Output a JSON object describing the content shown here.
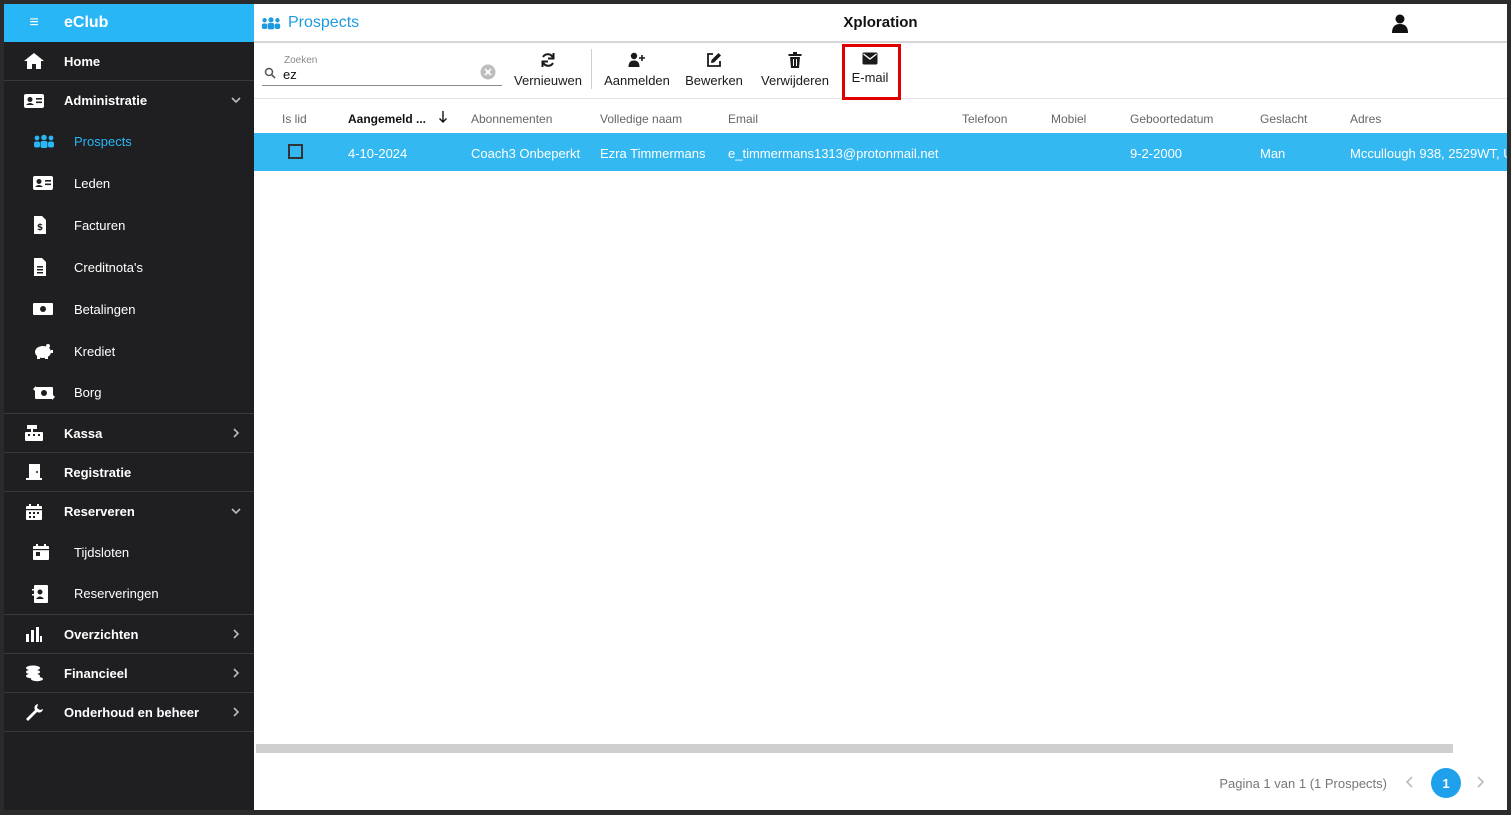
{
  "app": {
    "brand": "eClub",
    "org_title": "Xploration",
    "page_title": "Prospects"
  },
  "sidebar": {
    "home": "Home",
    "administratie": "Administratie",
    "admin_items": [
      "Prospects",
      "Leden",
      "Facturen",
      "Creditnota's",
      "Betalingen",
      "Krediet",
      "Borg"
    ],
    "kassa": "Kassa",
    "registratie": "Registratie",
    "reserveren": "Reserveren",
    "res_items": [
      "Tijdsloten",
      "Reserveringen"
    ],
    "overzichten": "Overzichten",
    "financieel": "Financieel",
    "onderhoud": "Onderhoud en beheer"
  },
  "search": {
    "placeholder": "Zoeken",
    "value": "ez"
  },
  "toolbar": {
    "refresh": "Vernieuwen",
    "register": "Aanmelden",
    "edit": "Bewerken",
    "delete": "Verwijderen",
    "email": "E-mail"
  },
  "table": {
    "columns": [
      "Is lid",
      "Aangemeld ...",
      "Abonnementen",
      "Volledige naam",
      "Email",
      "Telefoon",
      "Mobiel",
      "Geboortedatum",
      "Geslacht",
      "Adres"
    ],
    "rows": [
      {
        "aangemeld": "4-10-2024",
        "abonnementen": "Coach3 Onbeperkt",
        "naam": "Ezra Timmermans",
        "email": "e_timmermans1313@protonmail.net",
        "telefoon": "",
        "mobiel": "",
        "geboortedatum": "9-2-2000",
        "geslacht": "Man",
        "adres": "Mccullough 938, 2529WT, U"
      }
    ]
  },
  "pager": {
    "text": "Pagina 1 van 1 (1 Prospects)",
    "current": "1"
  },
  "colors": {
    "accent": "#29b6f6",
    "selected_row": "#34b8f2",
    "sidebar_bg": "#1f1f22",
    "highlight": "#e00000"
  }
}
